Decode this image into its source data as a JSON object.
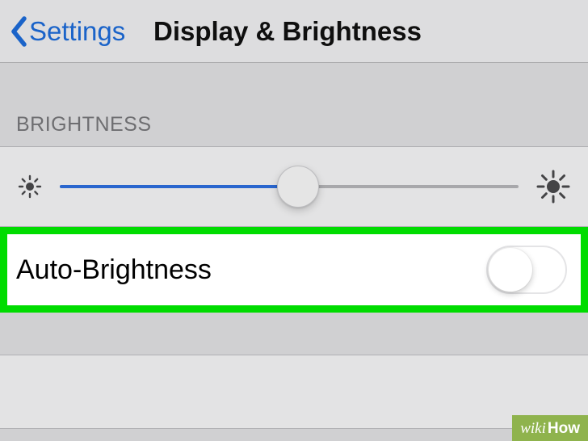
{
  "nav": {
    "back_label": "Settings",
    "title": "Display & Brightness"
  },
  "section": {
    "brightness_header": "BRIGHTNESS"
  },
  "brightness": {
    "slider_percent": 52
  },
  "auto": {
    "label": "Auto-Brightness",
    "on": false
  },
  "watermark": {
    "left": "wiki",
    "right": "How"
  },
  "colors": {
    "ios_blue": "#2f72e6",
    "highlight_green": "#00dc00",
    "wikihow_green": "#8fb34d"
  }
}
